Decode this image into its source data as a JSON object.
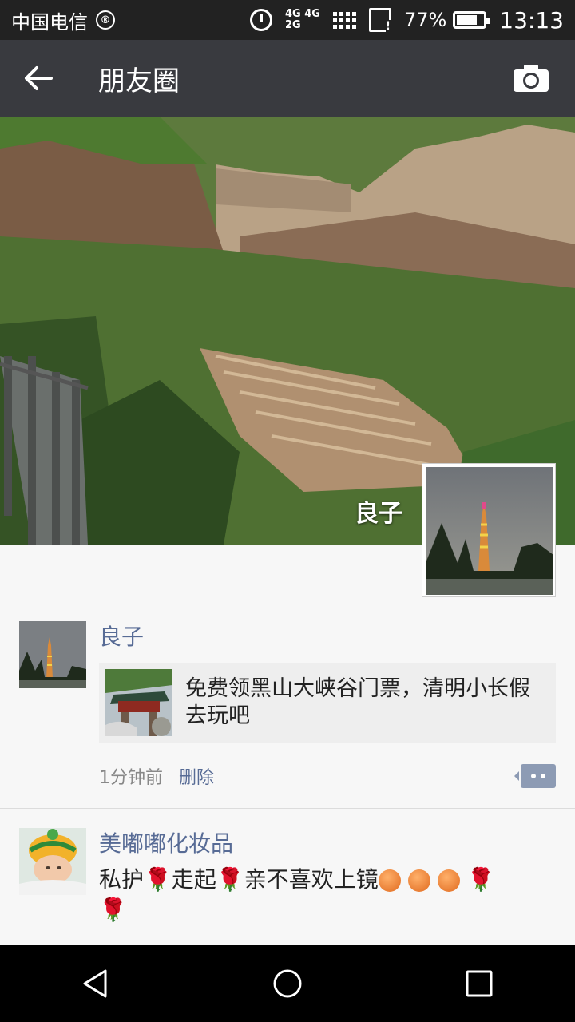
{
  "status_bar": {
    "carrier": "中国电信",
    "network_top": "4G 4G",
    "network_bottom": "2G",
    "battery_percent": "77%",
    "battery_level": 0.77,
    "time": "13:13"
  },
  "top_bar": {
    "title": "朋友圈"
  },
  "cover": {
    "owner_name": "良子"
  },
  "posts": [
    {
      "name": "良子",
      "share_text": "免费领黑山大峡谷门票，清明小长假去玩吧",
      "time": "1分钟前",
      "delete_label": "删除"
    },
    {
      "name": "美嘟嘟化妆品",
      "text_parts": [
        "私护",
        "走起",
        "亲不喜欢上镜"
      ]
    }
  ],
  "icons": {
    "back": "arrow-left-icon",
    "camera": "camera-icon",
    "comment": "comment-more-icon",
    "nav_back": "triangle-back-icon",
    "nav_home": "circle-home-icon",
    "nav_recent": "square-recent-icon"
  },
  "colors": {
    "top_bar": "#393a3f",
    "link": "#576b95",
    "rose": "#d4261f"
  }
}
